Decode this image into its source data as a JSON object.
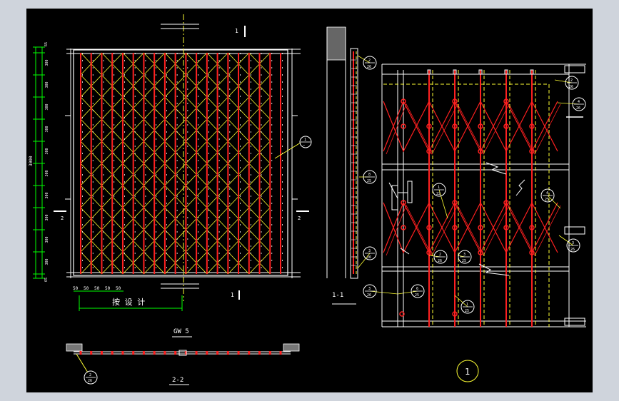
{
  "colors": {
    "background": "#000000",
    "frame": "#cfd4dc",
    "structure": "#ffffff",
    "bars": "#ff2020",
    "lattice": "#ffff33",
    "hidden": "#ffff33",
    "callout": "#ffffff"
  },
  "elevation": {
    "section_mark_top": "1",
    "section_mark_bottom": "1",
    "section_mark_left": "2",
    "section_mark_right": "2",
    "total_height_label": "3000",
    "dim_top": "65",
    "dim_bottom": "65",
    "dim_segment": "300",
    "dim_segments_count": 10,
    "bottom_dims": [
      "50",
      "50",
      "50",
      "50",
      "50"
    ],
    "design_note": "按 设 计",
    "callout_top": "1",
    "callout_bottom": "—",
    "title": "GW 5"
  },
  "section_1_1": {
    "label": "1-1",
    "callouts": [
      {
        "top": "2",
        "bottom": "26"
      },
      {
        "top": "8",
        "bottom": "25"
      },
      {
        "top": "3",
        "bottom": "26"
      },
      {
        "top": "3",
        "bottom": "26"
      },
      {
        "top": "6",
        "bottom": "25"
      }
    ]
  },
  "section_2_2": {
    "label": "2-2",
    "callout": {
      "top": "2",
      "bottom": "26"
    }
  },
  "detail_1": {
    "label": "1",
    "callouts": [
      {
        "top": "2",
        "bottom": "26"
      },
      {
        "top": "4",
        "bottom": "26"
      },
      {
        "top": "1",
        "bottom": "22"
      },
      {
        "top": "4",
        "bottom": "25"
      },
      {
        "top": "3",
        "bottom": "26"
      },
      {
        "top": "2",
        "bottom": "26"
      },
      {
        "top": "3",
        "bottom": "25"
      },
      {
        "top": "1",
        "bottom": "25"
      }
    ]
  }
}
